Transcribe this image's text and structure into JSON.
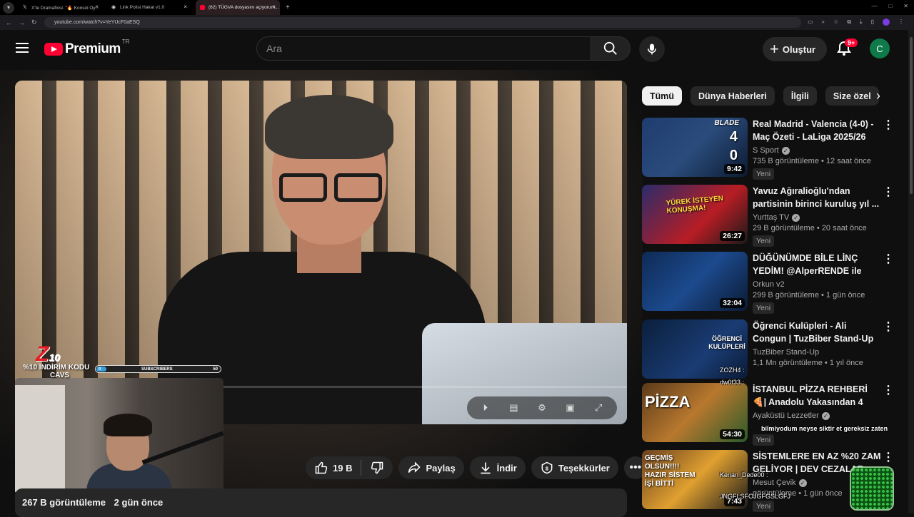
{
  "browser": {
    "tabs": [
      {
        "title": "X'te Dramaflosi: \"🔥 Konsol Oy..."
      },
      {
        "title": "Link Polisi Hakat v1.0"
      },
      {
        "title": "(62) TÜGVA dosyasını açıyorum..."
      }
    ],
    "url": "youtube.com/watch?v=YeYUcF0aESQ"
  },
  "header": {
    "logo_text": "Premium",
    "logo_suffix": "TR",
    "search_placeholder": "Ara",
    "create_label": "Oluştur",
    "notification_count": "9+",
    "avatar_initial": "C"
  },
  "overlay": {
    "brand": "Z",
    "brand_sup": "10",
    "promo_line1": "%10 İNDİRİM KODU",
    "promo_line2": "CAVS",
    "subs_label": "SUBSCRIBERS",
    "subs_current": "0",
    "subs_goal": "50",
    "subs_progress": 0.08
  },
  "actions": {
    "like_count": "19 B",
    "share_label": "Paylaş",
    "download_label": "İndir",
    "thanks_label": "Teşekkürler"
  },
  "description": {
    "views": "267 B görüntüleme",
    "date": "2 gün önce"
  },
  "chips": [
    "Tümü",
    "Dünya Haberleri",
    "İlgili",
    "Size özel"
  ],
  "recommendations": [
    {
      "title": "Real Madrid - Valencia (4-0) - Maç Özeti - LaLiga 2025/26",
      "channel": "S Sport",
      "verified": true,
      "views": "735 B görüntüleme",
      "age": "12 saat önce",
      "badge": "Yeni",
      "duration": "9:42",
      "thumb_text": "BLADE"
    },
    {
      "title": "Yavuz Ağıralioğlu'ndan partisinin birinci kuruluş yıl ...",
      "channel": "Yurttaş TV",
      "verified": true,
      "views": "29 B görüntüleme",
      "age": "20 saat önce",
      "badge": "Yeni",
      "duration": "26:27",
      "thumb_text": "YÜREK İSTEYEN KONUŞMA!"
    },
    {
      "title": "DÜĞÜNÜMDE BİLE LİNÇ YEDİM! @AlperRENDE ile #OrkCast",
      "channel": "Orkun v2",
      "verified": false,
      "views": "299 B görüntüleme",
      "age": "1 gün önce",
      "badge": "Yeni",
      "duration": "32:04",
      "thumb_text": ""
    },
    {
      "title": "Öğrenci Kulüpleri - Ali Congun | TuzBiber Stand-Up",
      "channel": "TuzBiber Stand-Up",
      "verified": false,
      "views": "1,1 Mn görüntüleme",
      "age": "1 yıl önce",
      "badge": "",
      "duration": "",
      "thumb_text": "ÖĞRENCİ KULÜPLERİ"
    },
    {
      "title": "İSTANBUL PİZZA REHBERİ 🍕| Anadolu Yakasından 4 Pizza ...",
      "channel": "Ayaküstü Lezzetler",
      "verified": true,
      "views": "",
      "age": "",
      "badge": "Yeni",
      "duration": "54:30",
      "thumb_text": "PİZZA"
    },
    {
      "title": "SİSTEMLERE EN AZ %20 ZAM GELİYOR | DEV CEZALAR ...",
      "channel": "Mesut Çevik",
      "verified": true,
      "views": "görüntüleme",
      "age": "1 gün önce",
      "badge": "Yeni",
      "duration": "7:43",
      "thumb_text": "GEÇMİŞ OLSUN!!!! HAZIR SİSTEM İŞİ BİTTİ"
    }
  ],
  "chat": [
    {
      "user": "ZOZH4 :"
    },
    {
      "user": "dw0f33 :"
    },
    {
      "user": "Kenan_Dede00 :"
    },
    {
      "user": "JNGFLSFOJGFGSLGFJ"
    }
  ],
  "chat_message": "bilmiyodum neyse siktir et gereksiz zaten"
}
